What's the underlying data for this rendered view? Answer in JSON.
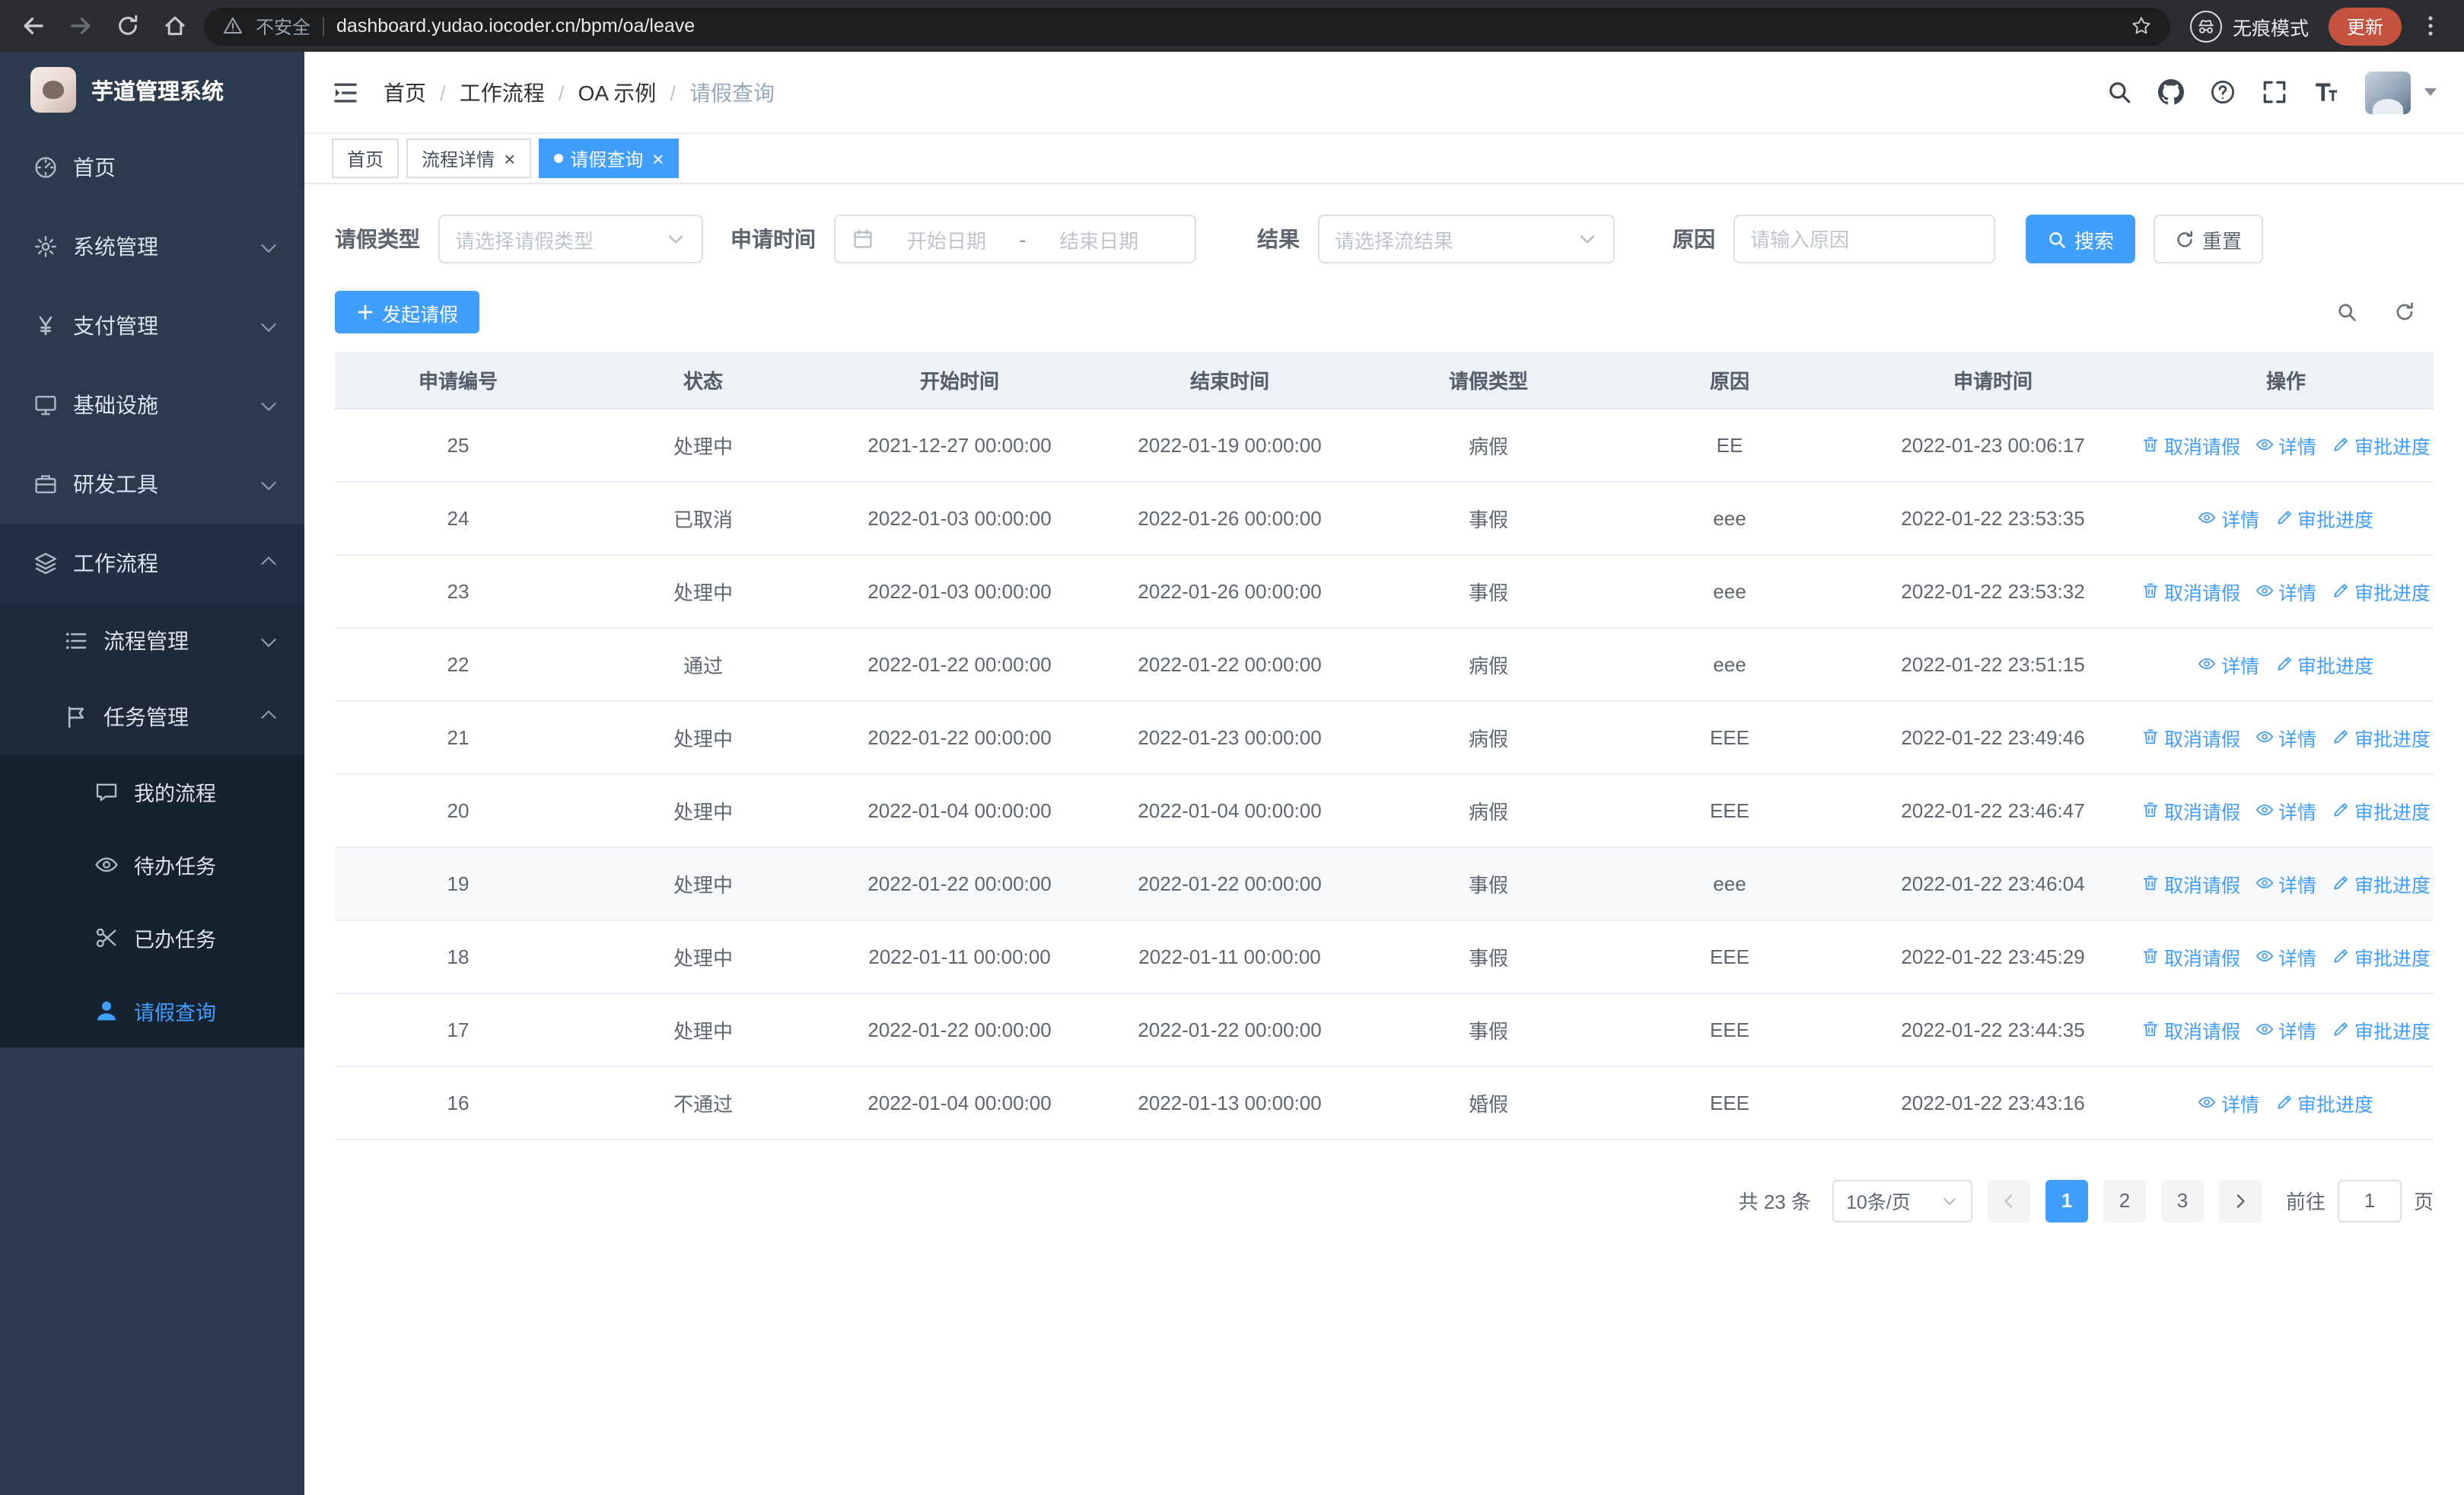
{
  "colors": {
    "primary": "#409eff",
    "sidebar_bg": "#2c3a4d",
    "update_pill": "#c5523f"
  },
  "browser": {
    "security_label": "不安全",
    "url": "dashboard.yudao.iocoder.cn/bpm/oa/leave",
    "incognito_label": "无痕模式",
    "update_label": "更新",
    "icons": [
      "back",
      "forward",
      "refresh",
      "home",
      "warning",
      "star",
      "incognito",
      "kebab-menu"
    ]
  },
  "sidebar": {
    "app_title": "芋道管理系统",
    "menu": [
      {
        "id": "home",
        "label": "首页",
        "icon": "dashboard",
        "level": 1
      },
      {
        "id": "system",
        "label": "系统管理",
        "icon": "gear",
        "level": 1,
        "chevron": "down"
      },
      {
        "id": "payment",
        "label": "支付管理",
        "icon": "yen",
        "level": 1,
        "chevron": "down"
      },
      {
        "id": "infrastructure",
        "label": "基础设施",
        "icon": "monitor",
        "level": 1,
        "chevron": "down"
      },
      {
        "id": "dev-tools",
        "label": "研发工具",
        "icon": "briefcase",
        "level": 1,
        "chevron": "down"
      },
      {
        "id": "workflow",
        "label": "工作流程",
        "icon": "layers",
        "level": 1,
        "chevron": "up",
        "open": true
      },
      {
        "id": "process-mgmt",
        "label": "流程管理",
        "icon": "list",
        "level": 2,
        "chevron": "down",
        "open": true
      },
      {
        "id": "task-mgmt",
        "label": "任务管理",
        "icon": "flag",
        "level": 2,
        "chevron": "up",
        "open": true
      },
      {
        "id": "my-process",
        "label": "我的流程",
        "icon": "chat",
        "level": 3,
        "open": true
      },
      {
        "id": "todo-tasks",
        "label": "待办任务",
        "icon": "eye",
        "level": 3,
        "open": true
      },
      {
        "id": "done-tasks",
        "label": "已办任务",
        "icon": "scissors",
        "level": 3,
        "open": true
      },
      {
        "id": "leave-query",
        "label": "请假查询",
        "icon": "user",
        "level": 3,
        "open": true,
        "active": true
      }
    ]
  },
  "header": {
    "breadcrumb": [
      "首页",
      "工作流程",
      "OA 示例",
      "请假查询"
    ],
    "right_icons": [
      "search",
      "github",
      "help",
      "fullscreen",
      "font-size",
      "avatar",
      "caret-down"
    ]
  },
  "tabs": [
    {
      "label": "首页",
      "closable": false,
      "active": false
    },
    {
      "label": "流程详情",
      "closable": true,
      "active": false
    },
    {
      "label": "请假查询",
      "closable": true,
      "active": true
    }
  ],
  "filters": {
    "leave_type_label": "请假类型",
    "leave_type_placeholder": "请选择请假类型",
    "apply_time_label": "申请时间",
    "start_date_placeholder": "开始日期",
    "range_separator": "-",
    "end_date_placeholder": "结束日期",
    "result_label": "结果",
    "result_placeholder": "请选择流结果",
    "reason_label": "原因",
    "reason_placeholder": "请输入原因",
    "search_label": "搜索",
    "reset_label": "重置"
  },
  "toolbar": {
    "create_label": "发起请假"
  },
  "table": {
    "headers": [
      "申请编号",
      "状态",
      "开始时间",
      "结束时间",
      "请假类型",
      "原因",
      "申请时间",
      "操作"
    ],
    "actions": {
      "cancel": "取消请假",
      "detail": "详情",
      "progress": "审批进度"
    },
    "action_icons": {
      "cancel": "delete",
      "detail": "eye",
      "progress": "edit"
    },
    "rows": [
      {
        "id": "25",
        "status": "处理中",
        "start": "2021-12-27 00:00:00",
        "end": "2022-01-19 00:00:00",
        "type": "病假",
        "reason": "EE",
        "applied": "2022-01-23 00:06:17",
        "cancelable": true
      },
      {
        "id": "24",
        "status": "已取消",
        "start": "2022-01-03 00:00:00",
        "end": "2022-01-26 00:00:00",
        "type": "事假",
        "reason": "eee",
        "applied": "2022-01-22 23:53:35",
        "cancelable": false
      },
      {
        "id": "23",
        "status": "处理中",
        "start": "2022-01-03 00:00:00",
        "end": "2022-01-26 00:00:00",
        "type": "事假",
        "reason": "eee",
        "applied": "2022-01-22 23:53:32",
        "cancelable": true
      },
      {
        "id": "22",
        "status": "通过",
        "start": "2022-01-22 00:00:00",
        "end": "2022-01-22 00:00:00",
        "type": "病假",
        "reason": "eee",
        "applied": "2022-01-22 23:51:15",
        "cancelable": false
      },
      {
        "id": "21",
        "status": "处理中",
        "start": "2022-01-22 00:00:00",
        "end": "2022-01-23 00:00:00",
        "type": "病假",
        "reason": "EEE",
        "applied": "2022-01-22 23:49:46",
        "cancelable": true
      },
      {
        "id": "20",
        "status": "处理中",
        "start": "2022-01-04 00:00:00",
        "end": "2022-01-04 00:00:00",
        "type": "病假",
        "reason": "EEE",
        "applied": "2022-01-22 23:46:47",
        "cancelable": true
      },
      {
        "id": "19",
        "status": "处理中",
        "start": "2022-01-22 00:00:00",
        "end": "2022-01-22 00:00:00",
        "type": "事假",
        "reason": "eee",
        "applied": "2022-01-22 23:46:04",
        "cancelable": true,
        "highlighted": true
      },
      {
        "id": "18",
        "status": "处理中",
        "start": "2022-01-11 00:00:00",
        "end": "2022-01-11 00:00:00",
        "type": "事假",
        "reason": "EEE",
        "applied": "2022-01-22 23:45:29",
        "cancelable": true
      },
      {
        "id": "17",
        "status": "处理中",
        "start": "2022-01-22 00:00:00",
        "end": "2022-01-22 00:00:00",
        "type": "事假",
        "reason": "EEE",
        "applied": "2022-01-22 23:44:35",
        "cancelable": true
      },
      {
        "id": "16",
        "status": "不通过",
        "start": "2022-01-04 00:00:00",
        "end": "2022-01-13 00:00:00",
        "type": "婚假",
        "reason": "EEE",
        "applied": "2022-01-22 23:43:16",
        "cancelable": false
      }
    ]
  },
  "pagination": {
    "total_label": "共 23 条",
    "page_size_label": "10条/页",
    "pages": [
      "1",
      "2",
      "3"
    ],
    "active_page": "1",
    "goto_label": "前往",
    "goto_value": "1",
    "page_unit_label": "页"
  }
}
